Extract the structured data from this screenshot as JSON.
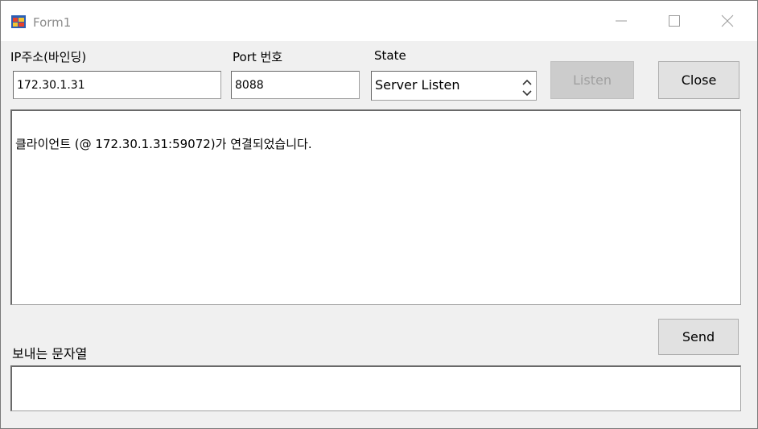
{
  "window": {
    "title": "Form1"
  },
  "ip": {
    "label": "IP주소(바인딩)",
    "value": "172.30.1.31"
  },
  "port": {
    "label": "Port 번호",
    "value": "8088"
  },
  "state": {
    "label": "State",
    "value": "Server Listen"
  },
  "buttons": {
    "listen": "Listen",
    "close": "Close",
    "send": "Send"
  },
  "log": {
    "lines": [
      "클라이언트 (@ 172.30.1.31:59072)가 연결되었습니다."
    ]
  },
  "send_area": {
    "label": "보내는 문자열",
    "value": ""
  },
  "icons": {
    "app": "form-app-icon",
    "minimize": "minimize-icon",
    "maximize": "maximize-icon",
    "close": "close-icon",
    "spinner": "up-down-spinner-icon"
  }
}
